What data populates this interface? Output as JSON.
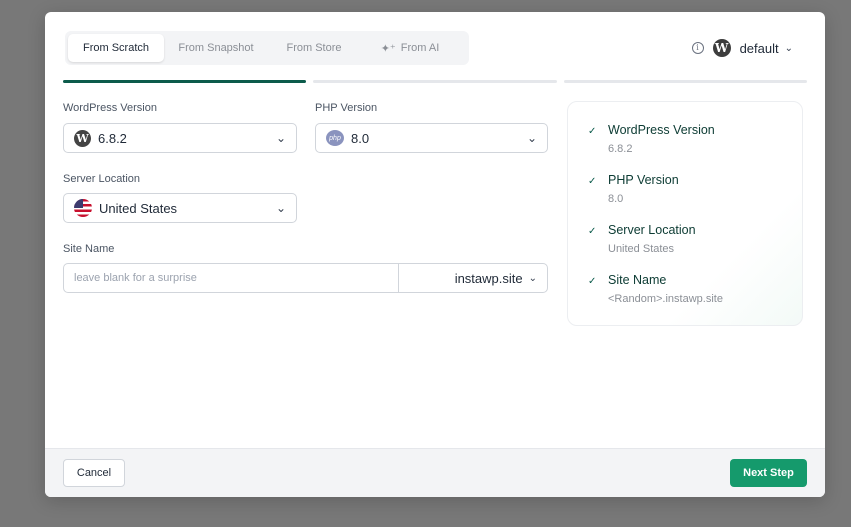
{
  "tabs": [
    {
      "label": "From Scratch",
      "active": true
    },
    {
      "label": "From Snapshot",
      "active": false
    },
    {
      "label": "From Store",
      "active": false
    },
    {
      "label": "From AI",
      "active": false,
      "icon": "sparkle-icon"
    }
  ],
  "account": {
    "name": "default"
  },
  "progress": {
    "steps_total": 3,
    "current_step": 1
  },
  "form": {
    "wordpress_version": {
      "label": "WordPress Version",
      "value": "6.8.2"
    },
    "php_version": {
      "label": "PHP Version",
      "value": "8.0"
    },
    "server_location": {
      "label": "Server Location",
      "value": "United States"
    },
    "site_name": {
      "label": "Site Name",
      "placeholder": "leave blank for a surprise",
      "value": "",
      "domain": "instawp.site"
    }
  },
  "summary": [
    {
      "title": "WordPress Version",
      "value": "6.8.2"
    },
    {
      "title": "PHP Version",
      "value": "8.0"
    },
    {
      "title": "Server Location",
      "value": "United States"
    },
    {
      "title": "Site Name",
      "value": "<Random>.instawp.site"
    }
  ],
  "footer": {
    "cancel_label": "Cancel",
    "next_label": "Next Step"
  },
  "colors": {
    "accent": "#159a6c",
    "accent_dark": "#0c5b4b",
    "overlay": "#787878"
  }
}
